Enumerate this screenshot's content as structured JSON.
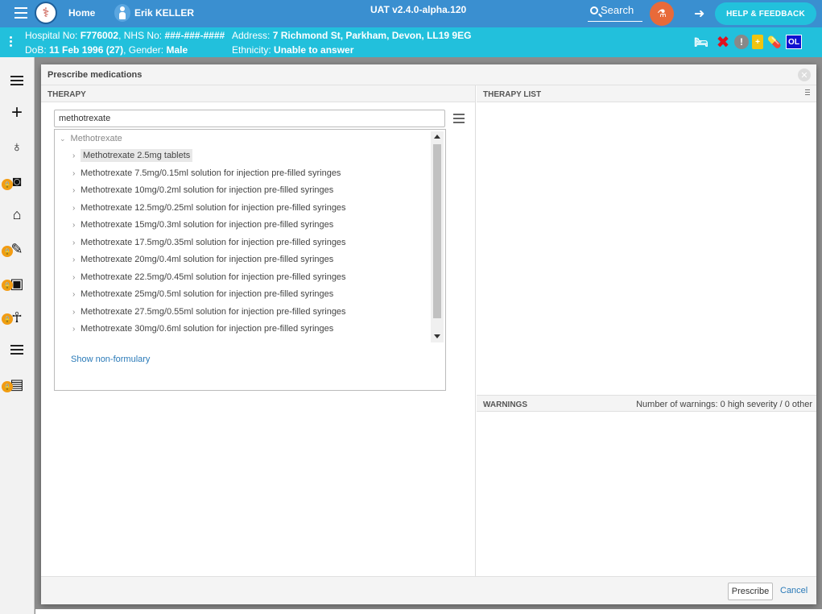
{
  "topbar": {
    "home_label": "Home",
    "user_name": "Erik KELLER",
    "version": "UAT v2.4.0-alpha.120",
    "search_label": "Search",
    "help_label": "HELP & FEEDBACK",
    "accent": "#3a8fd0"
  },
  "patient": {
    "line1_a_label": "Hospital No: ",
    "hospital_no": "F776002",
    "line1_b_label": ", NHS No: ",
    "nhs_no": "###-###-####",
    "address_label": "Address: ",
    "address": "7 Richmond St, Parkham, Devon, LL19 9EG",
    "dob_label": "DoB: ",
    "dob": "11 Feb 1996 (27)",
    "gender_label": ", Gender: ",
    "gender": "Male",
    "ethnicity_label": "Ethnicity: ",
    "ethnicity": "Unable to answer",
    "ol_badge": "OL",
    "accent": "#22c0dc"
  },
  "modal": {
    "title": "Prescribe medications",
    "therapy_header": "THERAPY",
    "therapy_list_header": "THERAPY LIST",
    "warnings_header": "WARNINGS",
    "warnings_count": "Number of warnings: 0 high severity / 0 other",
    "search_value": "methotrexate",
    "group_label": "Methotrexate",
    "items": [
      "Methotrexate 2.5mg tablets",
      "Methotrexate 7.5mg/0.15ml solution for injection pre-filled syringes",
      "Methotrexate 10mg/0.2ml solution for injection pre-filled syringes",
      "Methotrexate 12.5mg/0.25ml solution for injection pre-filled syringes",
      "Methotrexate 15mg/0.3ml solution for injection pre-filled syringes",
      "Methotrexate 17.5mg/0.35ml solution for injection pre-filled syringes",
      "Methotrexate 20mg/0.4ml solution for injection pre-filled syringes",
      "Methotrexate 22.5mg/0.45ml solution for injection pre-filled syringes",
      "Methotrexate 25mg/0.5ml solution for injection pre-filled syringes",
      "Methotrexate 27.5mg/0.55ml solution for injection pre-filled syringes",
      "Methotrexate 30mg/0.6ml solution for injection pre-filled syringes"
    ],
    "show_non_formulary": "Show non-formulary",
    "prescribe_label": "Prescribe",
    "cancel_label": "Cancel"
  }
}
